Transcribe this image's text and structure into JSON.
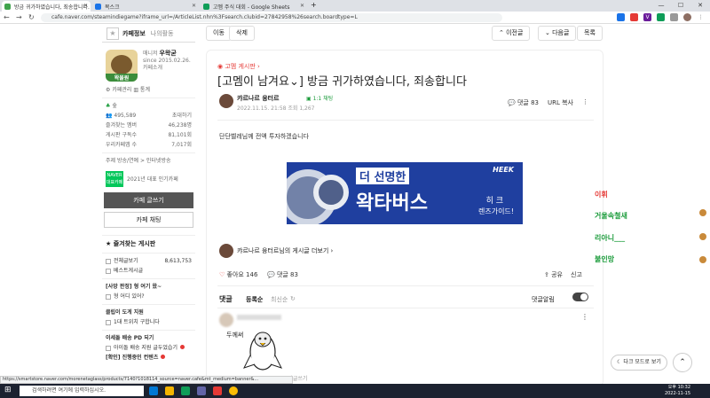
{
  "browser": {
    "tabs": [
      {
        "title": "방금 귀가하였습니다, 죄송합니다.",
        "color": "#3fa34d"
      },
      {
        "title": "목스크",
        "color": "#1a73e8"
      },
      {
        "title": "고멤 주식 대회 - Google Sheets",
        "color": "#0f9d58"
      }
    ],
    "new_tab": "+",
    "url": "cafe.naver.com/steamindiegame?iframe_url=/ArticleList.nhn%3Fsearch.clubid=27842958%26search.boardtype=L",
    "window_controls": [
      "—",
      "☐",
      "✕"
    ]
  },
  "sidebar": {
    "tab_cafe_info": "카페정보",
    "tab_my_activity": "나의활동",
    "manager_label": "매니저",
    "manager_name": "우왁굳",
    "since": "since 2015.02.26.",
    "cafe_intro": "카페소개",
    "avatar_text": "왁물원",
    "cafe_manage": "카페관리",
    "stats": "통계",
    "level_label": "숲",
    "members_count": "495,589",
    "invite": "초대하기",
    "fav_members_label": "즐겨찾는 멤버",
    "fav_members_value": "46,238명",
    "post_subscribers_label": "게시판 구독수",
    "post_subscribers_value": "81,101회",
    "article_count_label": "우리카페앱 수",
    "article_count_value": "7,017회",
    "theme_line": "주제 방송/연예 > 인터넷방송",
    "naver_badge": "NAVER 대표카페",
    "popular_cafe": "2021년 대표 인기카페",
    "write_button": "카페 글쓰기",
    "chat_button": "카페 채팅",
    "fav_board_title": "즐겨찾는 게시판",
    "all_posts_label": "전체글보기",
    "all_posts_count": "8,613,753",
    "best_posts": "베스트게시글",
    "menu": [
      "[사망 판정] 형 여기 왔~",
      "형 어디 있어?",
      "클립이 도게 지원",
      "1대 트위치 구합니다",
      "이세돌 배송 PD 되기",
      "아이돌 배송 지원 글두었습기",
      "[확인] 진행중인 컨텐츠"
    ]
  },
  "toolbar": {
    "move": "이동",
    "delete": "삭제",
    "prev": "이전글",
    "next": "다음글",
    "list": "목록"
  },
  "article": {
    "board": "고멤 게시판",
    "title": "[고멤이 남겨요⌄] 방금 귀가하였습니다, 죄송합니다",
    "author": "캬르나르 융터르",
    "level": "1:1 채팅",
    "date_views": "2022.11.15. 21:58  조회 1,267",
    "comments_label": "댓글 83",
    "url_copy": "URL 복사",
    "body_text": "단단벨레님께 전액 투자하겠습니다",
    "banner": {
      "top": "더 선명한",
      "main": "왁타버스",
      "brand": "HEEK",
      "sub1": "히 크",
      "sub2": "렌즈가이드!"
    },
    "more_posts": "캬르나르 융터르님의 게시글 더보기 ›",
    "like": "좋아요 146",
    "comment": "댓글 83",
    "share": "공유",
    "report": "신고"
  },
  "comments": {
    "header": "댓글",
    "sort_reg": "등록순",
    "sort_new": "최신순",
    "alert_label": "댓글알림",
    "sticker_text": "두께써",
    "meta": "2022.11.15. 21:58  답글쓰기"
  },
  "chat": {
    "lines": [
      {
        "text": "이휘",
        "color": "#e53935"
      },
      {
        "text": "거울속철새",
        "color": "#1a9b3a"
      },
      {
        "text": "리아니___",
        "color": "#1a9b3a"
      },
      {
        "text": "불인망",
        "color": "#1a9b3a"
      }
    ]
  },
  "float": {
    "dark_mode": "다크 모드로 보기",
    "top": "⌃"
  },
  "status_url": "https://smartstore.naver.com/morenetaglass/products/7140?1018114_source=naver.cafe&mt_medium=banner&...",
  "taskbar": {
    "search_placeholder": "검색하려면 여기에 입력하십시오.",
    "time": "오후 10:32",
    "date": "2022-11-15"
  }
}
